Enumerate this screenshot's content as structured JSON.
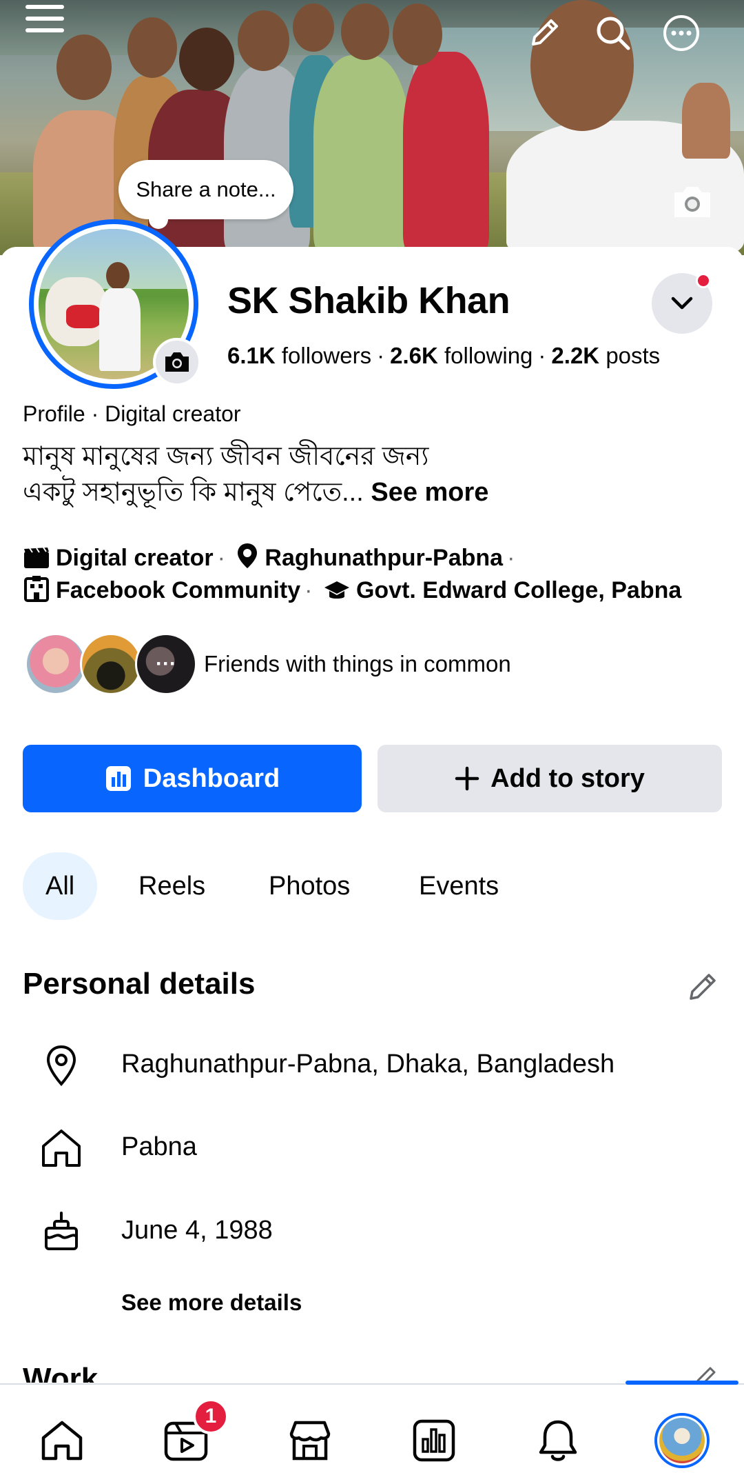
{
  "cover": {
    "note_placeholder": "Share a note...",
    "icons": [
      "menu-icon",
      "pencil-icon",
      "search-icon",
      "more-icon",
      "camera-icon"
    ]
  },
  "profile": {
    "name": "SK Shakib Khan",
    "followers_count": "6.1K",
    "followers_label": "followers",
    "following_count": "2.6K",
    "following_label": "following",
    "posts_count": "2.2K",
    "posts_label": "posts",
    "category": "Profile · Digital creator",
    "bio_line1": "মানুষ  মানুষের জন্য জীবন জীবনের জন্য",
    "bio_line2": "একটু সহানুভূতি কি মানুষ  পেতে...",
    "bio_see_more": "See more"
  },
  "intro": {
    "creator": "Digital creator",
    "location": "Raghunathpur-Pabna",
    "community": "Facebook Community",
    "education": "Govt. Edward College, Pabna"
  },
  "friends": {
    "label": "Friends with things in common",
    "more_glyph": "···"
  },
  "actions": {
    "dashboard": "Dashboard",
    "add_story": "Add to story"
  },
  "tabs": [
    {
      "label": "All",
      "active": true
    },
    {
      "label": "Reels",
      "active": false
    },
    {
      "label": "Photos",
      "active": false
    },
    {
      "label": "Events",
      "active": false
    }
  ],
  "personal_details": {
    "title": "Personal details",
    "location": "Raghunathpur-Pabna, Dhaka, Bangladesh",
    "hometown": "Pabna",
    "birthday": "June 4, 1988",
    "see_more": "See more details"
  },
  "work": {
    "title": "Work"
  },
  "bottom_nav": {
    "items": [
      "home-icon",
      "video-icon",
      "marketplace-icon",
      "dashboard-icon",
      "bell-icon",
      "profile-avatar"
    ],
    "video_badge": "1",
    "active": "profile-avatar"
  },
  "colors": {
    "primary": "#0866ff",
    "secondary_button": "#e4e6eb",
    "badge": "#e41e3f",
    "tab_active_bg": "#e7f3ff"
  }
}
